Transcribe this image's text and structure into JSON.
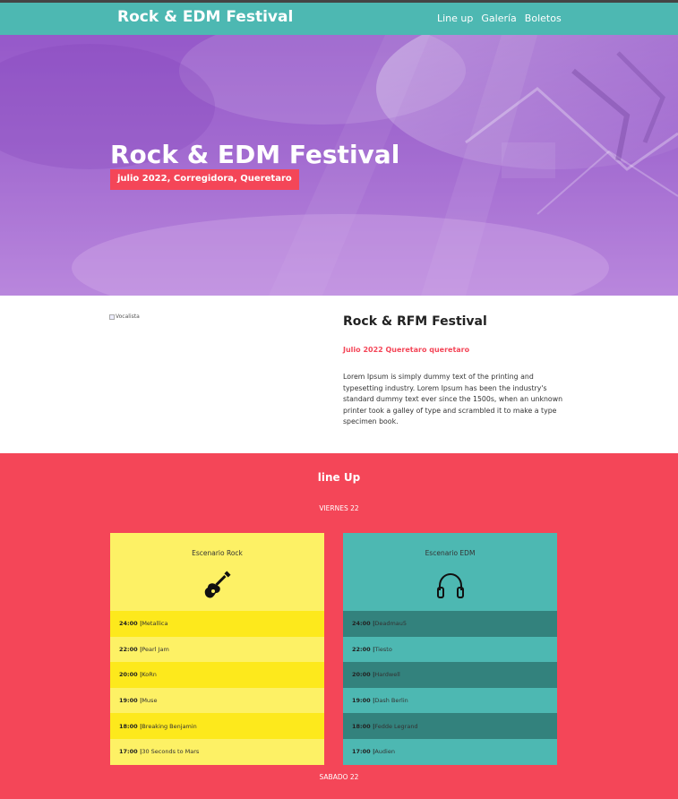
{
  "nav": {
    "brand": "Rock & EDM Festival",
    "links": [
      "Line up",
      "Galería",
      "Boletos"
    ]
  },
  "hero": {
    "title": "Rock & EDM Festival",
    "subtitle": "julio 2022, Corregidora, Queretaro"
  },
  "about": {
    "image_alt": "Vocalista",
    "title": "Rock & RFM Festival",
    "date": "Julio 2022 Queretaro queretaro",
    "text": "Lorem Ipsum is simply dummy text of the printing and typesetting industry. Lorem Ipsum has been the industry's standard dummy text ever since the 1500s, when an unknown printer took a galley of type and scrambled it to make a type specimen book."
  },
  "lineup": {
    "title": "line Up",
    "day1": "VIERNES 22",
    "day2": "SABADO 22",
    "stages": [
      {
        "name": "Escenario Rock",
        "icon": "guitar-icon",
        "acts": [
          {
            "time": "24:00 |",
            "band": " Metallica"
          },
          {
            "time": "22:00 |",
            "band": " Pearl Jam"
          },
          {
            "time": "20:00 |",
            "band": " Ko",
            "suffix": "Rn"
          },
          {
            "time": "19:00 |",
            "band": " Muse"
          },
          {
            "time": "18:00 |",
            "band": " Breaking Benjamin"
          },
          {
            "time": "17:00 |",
            "band": " 30 Seconds to Mars"
          }
        ]
      },
      {
        "name": "Escenario EDM",
        "icon": "headphones-icon",
        "acts": [
          {
            "time": "24:00 |",
            "band": " Deadmau5"
          },
          {
            "time": "22:00 |",
            "band": " Tiesto"
          },
          {
            "time": "20:00 |",
            "band": " Hardwell"
          },
          {
            "time": "19:00 |",
            "band": " Dash Berlin"
          },
          {
            "time": "18:00 |",
            "band": " Fedde Legrand"
          },
          {
            "time": "17:00 |",
            "band": " Audien"
          }
        ]
      }
    ]
  },
  "colors": {
    "teal": "#4db8b2",
    "teal_dark": "#33827d",
    "red": "#f44658",
    "yellow": "#fdf165",
    "yellow_dark": "#fde91c",
    "purple": "#9f66cf"
  }
}
